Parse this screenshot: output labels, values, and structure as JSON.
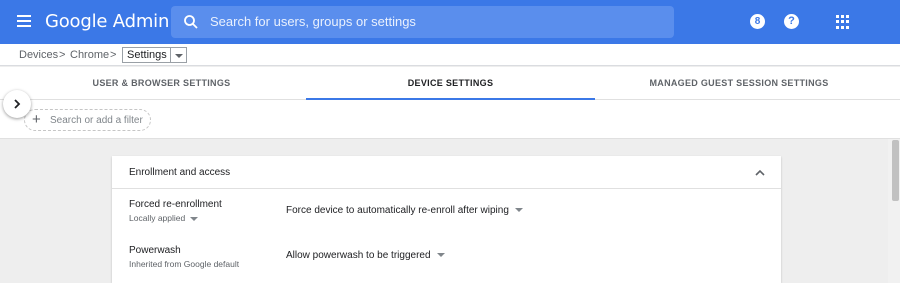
{
  "app": {
    "title": "Google Admin"
  },
  "search": {
    "placeholder": "Search for users, groups or settings"
  },
  "header_icons": {
    "notifications_count": "8",
    "help": "?"
  },
  "breadcrumb": {
    "items": [
      "Devices",
      "Chrome"
    ],
    "separator": ">",
    "current": "Settings"
  },
  "tabs": [
    {
      "label": "USER & BROWSER SETTINGS",
      "active": false
    },
    {
      "label": "DEVICE SETTINGS",
      "active": true
    },
    {
      "label": "MANAGED GUEST SESSION SETTINGS",
      "active": false
    }
  ],
  "filter": {
    "placeholder": "Search or add a filter"
  },
  "section": {
    "title": "Enrollment and access",
    "rows": [
      {
        "title": "Forced re-enrollment",
        "subtitle": "Locally applied",
        "value": "Force device to automatically re-enroll after wiping"
      },
      {
        "title": "Powerwash",
        "subtitle": "Inherited from Google default",
        "value": "Allow powerwash to be triggered"
      }
    ]
  },
  "colors": {
    "brand": "#3b78e7",
    "page_bg": "#eeeeee"
  }
}
